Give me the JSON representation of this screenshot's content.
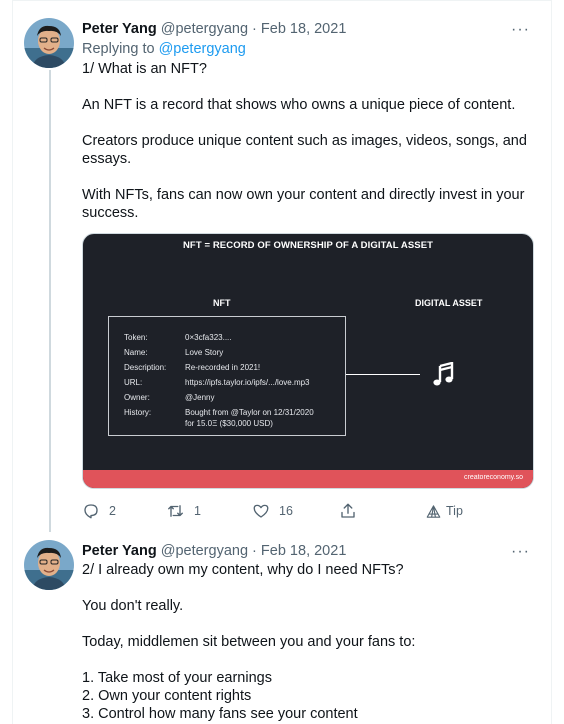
{
  "tweets": [
    {
      "name": "Peter Yang",
      "handle": "@petergyang",
      "separator": "·",
      "date": "Feb 18, 2021",
      "more": "···",
      "replying_prefix": "Replying to",
      "replying_handle": "@petergyang",
      "lines": [
        "1/ What is an NFT?",
        "An NFT is a record that shows who owns a unique piece of content.",
        "Creators produce unique content such as images, videos, songs, and",
        "essays.",
        "With NFTs, fans can now own your content and directly invest in your",
        "success."
      ],
      "media": {
        "title": "NFT = RECORD OF OWNERSHIP OF A DIGITAL ASSET",
        "nft_header": "NFT",
        "asset_header": "DIGITAL ASSET",
        "record": [
          {
            "key": "Token:",
            "value": "0×3cfa323...."
          },
          {
            "key": "Name:",
            "value": "Love Story"
          },
          {
            "key": "Description:",
            "value": "Re-recorded in 2021!"
          },
          {
            "key": "URL:",
            "value": "https://ipfs.taylor.io/ipfs/.../love.mp3"
          },
          {
            "key": "Owner:",
            "value": "@Jenny"
          },
          {
            "key": "History:",
            "value": "Bought from @Taylor on 12/31/2020"
          }
        ],
        "history_line2": "for 15.0Ξ ($30,000 USD)",
        "footer_credit": "creatoreconomy.so",
        "footer_color": "#e0535a"
      },
      "actions": {
        "replies": "2",
        "retweets": "1",
        "likes": "16",
        "tip": "Tip"
      }
    },
    {
      "name": "Peter Yang",
      "handle": "@petergyang",
      "separator": "·",
      "date": "Feb 18, 2021",
      "more": "···",
      "lines": [
        "2/ I already own my content, why do I need NFTs?",
        "You don't really.",
        "Today, middlemen sit between you and your fans to:",
        "1. Take most of your earnings",
        "2. Own your content rights",
        "3. Control how many fans see your content"
      ]
    }
  ],
  "colors": {
    "link": "#1d9bf0",
    "muted": "#536471",
    "text": "#0f1419",
    "thread_line": "#cfd9de"
  }
}
